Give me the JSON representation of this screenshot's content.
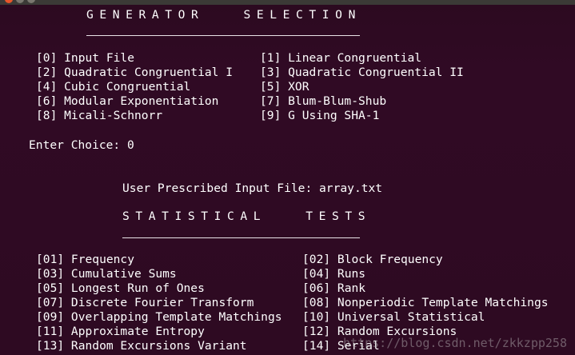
{
  "window": {
    "close_icon": "close-icon",
    "minimize_icon": "minimize-icon",
    "maximize_icon": "maximize-icon"
  },
  "generator": {
    "heading": "GENERATOR   SELECTION",
    "options": [
      "[0] Input File",
      "[1] Linear Congruential",
      "[2] Quadratic Congruential I",
      "[3] Quadratic Congruential II",
      "[4] Cubic Congruential",
      "[5] XOR",
      "[6] Modular Exponentiation",
      "[7] Blum-Blum-Shub",
      "[8] Micali-Schnorr",
      "[9] G Using SHA-1"
    ],
    "prompt": "Enter Choice: 0"
  },
  "input_file_line": "User Prescribed Input File: array.txt",
  "tests": {
    "heading": "STATISTICAL   TESTS",
    "options": [
      "[01] Frequency",
      "[02] Block Frequency",
      "[03] Cumulative Sums",
      "[04] Runs",
      "[05] Longest Run of Ones",
      "[06] Rank",
      "[07] Discrete Fourier Transform",
      "[08] Nonperiodic Template Matchings",
      "[09] Overlapping Template Matchings",
      "[10] Universal Statistical",
      "[11] Approximate Entropy",
      "[12] Random Excursions",
      "[13] Random Excursions Variant",
      "[14] Serial"
    ]
  },
  "watermark": "https://blog.csdn.net/zkkzpp258",
  "colors": {
    "background": "#300a24",
    "text": "#ffffff"
  }
}
